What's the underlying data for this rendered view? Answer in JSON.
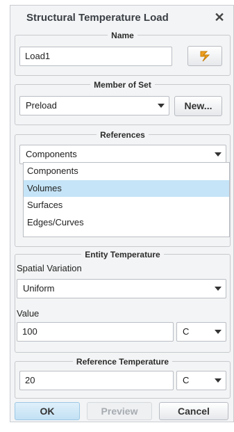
{
  "dialog": {
    "title": "Structural Temperature Load"
  },
  "name_group": {
    "legend": "Name",
    "value": "Load1"
  },
  "member_group": {
    "legend": "Member of Set",
    "selected": "Preload",
    "new_label": "New..."
  },
  "references_group": {
    "legend": "References",
    "selected": "Components",
    "options": [
      "Components",
      "Volumes",
      "Surfaces",
      "Edges/Curves"
    ],
    "highlighted": "Volumes"
  },
  "entity_group": {
    "legend": "Entity Temperature",
    "spatial_label": "Spatial Variation",
    "spatial_selected": "Uniform",
    "value_label": "Value",
    "value": "100",
    "unit": "C"
  },
  "reference_temp_group": {
    "legend": "Reference Temperature",
    "value": "20",
    "unit": "C"
  },
  "buttons": {
    "ok": "OK",
    "preview": "Preview",
    "cancel": "Cancel"
  },
  "colors": {
    "selection": "#c5e4f7",
    "ok_button": "#cfe6f5",
    "set_icon": "#f0a020"
  },
  "icons": {
    "close": "close-icon",
    "set_selector": "arrow-selector-icon",
    "dropdown": "chevron-down-icon"
  }
}
